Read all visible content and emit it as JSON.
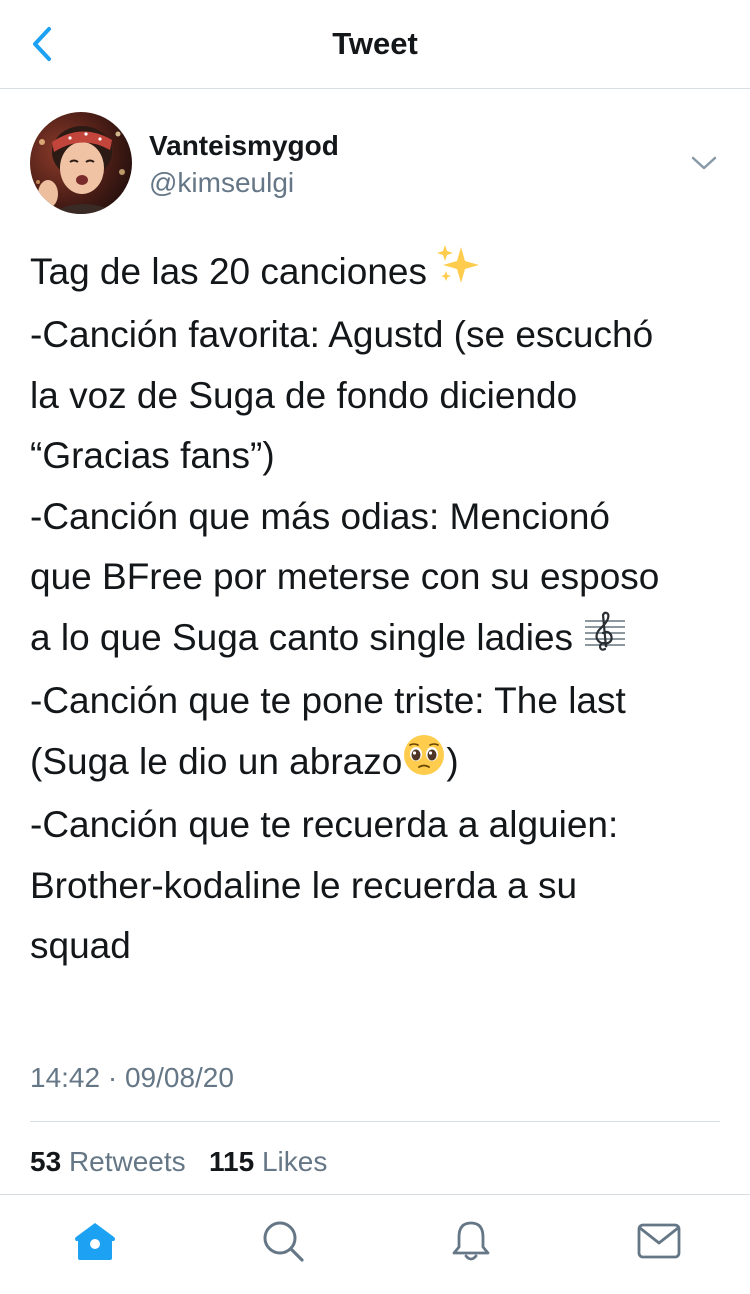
{
  "header": {
    "title": "Tweet",
    "back_icon": "chevron-left-icon"
  },
  "author": {
    "display_name": "Vanteismygod",
    "handle": "@kimseulgi"
  },
  "tweet": {
    "lines": [
      "Tag de las 20 canciones ",
      "-Canción favorita: Agustd (se escuchó",
      "la voz de Suga de fondo diciendo",
      "“Gracias fans”)",
      "-Canción que más odias: Mencionó",
      "que BFree por meterse con su esposo",
      "a lo que Suga canto single ladies ",
      "-Canción que te pone triste: The last",
      "(Suga le dio un abrazo",
      ")",
      "-Canción que te recuerda a alguien:",
      "Brother-kodaline le recuerda a su",
      "squad"
    ],
    "emojis": [
      "sparkles-icon",
      "treble-clef-icon",
      "pleading-face-icon"
    ]
  },
  "meta": {
    "timestamp": "14:42 · 09/08/20"
  },
  "stats": {
    "retweets_count": "53",
    "retweets_label": "Retweets",
    "likes_count": "115",
    "likes_label": "Likes"
  },
  "colors": {
    "accent": "#1da1f2",
    "text": "#14171a",
    "secondary": "#657786",
    "divider": "#d8dde2"
  },
  "tabbar": {
    "items": [
      "home-icon",
      "search-icon",
      "notifications-icon",
      "messages-icon"
    ],
    "active": "home-icon"
  }
}
